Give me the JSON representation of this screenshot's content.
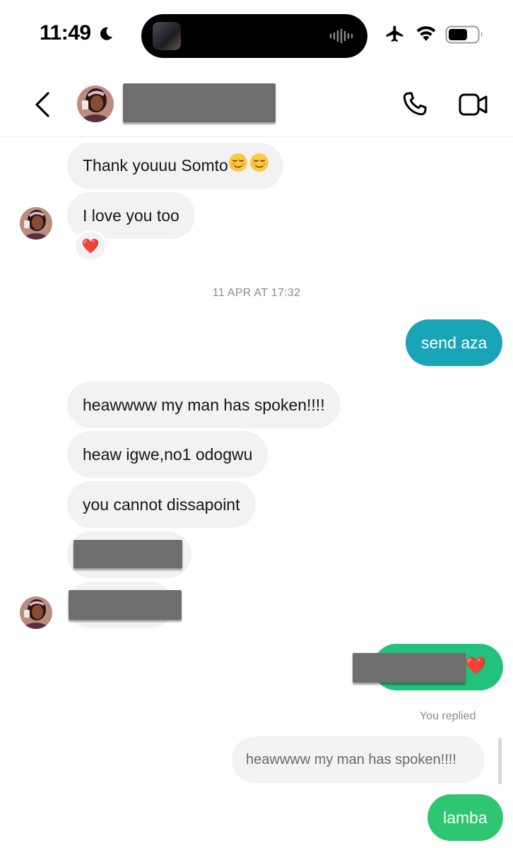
{
  "status_bar": {
    "time": "11:49"
  },
  "header": {
    "icons": [
      "back-icon",
      "phone-icon",
      "video-icon"
    ]
  },
  "messages": [
    {
      "id": "m1",
      "direction": "incoming",
      "text": "Thank youuu Somto"
    },
    {
      "id": "m2",
      "direction": "incoming",
      "text": "I love you too",
      "reaction": "❤️"
    },
    {
      "id": "ts",
      "type": "timestamp",
      "text": "11 APR AT 17:32"
    },
    {
      "id": "m3",
      "direction": "outgoing",
      "text": "send aza"
    },
    {
      "id": "m4",
      "direction": "incoming",
      "text": "heawwww my man has spoken!!!!"
    },
    {
      "id": "m5",
      "direction": "incoming",
      "text": "heaw igwe,no1 odogwu"
    },
    {
      "id": "m6",
      "direction": "incoming",
      "text": "you cannot dissapoint"
    },
    {
      "id": "m7",
      "direction": "incoming",
      "redacted": true
    },
    {
      "id": "m8",
      "direction": "incoming",
      "redacted": true
    },
    {
      "id": "m9",
      "direction": "outgoing",
      "redacted": true,
      "emoji": "❤️"
    },
    {
      "id": "reply",
      "label": "You replied",
      "quote": "heawwww my man has spoken!!!!"
    },
    {
      "id": "m10",
      "direction": "outgoing",
      "text": "lamba"
    }
  ],
  "colors": {
    "outgoing_blue": "#1aa4b7",
    "outgoing_green": "#22c27c",
    "incoming": "#f2f2f4"
  }
}
